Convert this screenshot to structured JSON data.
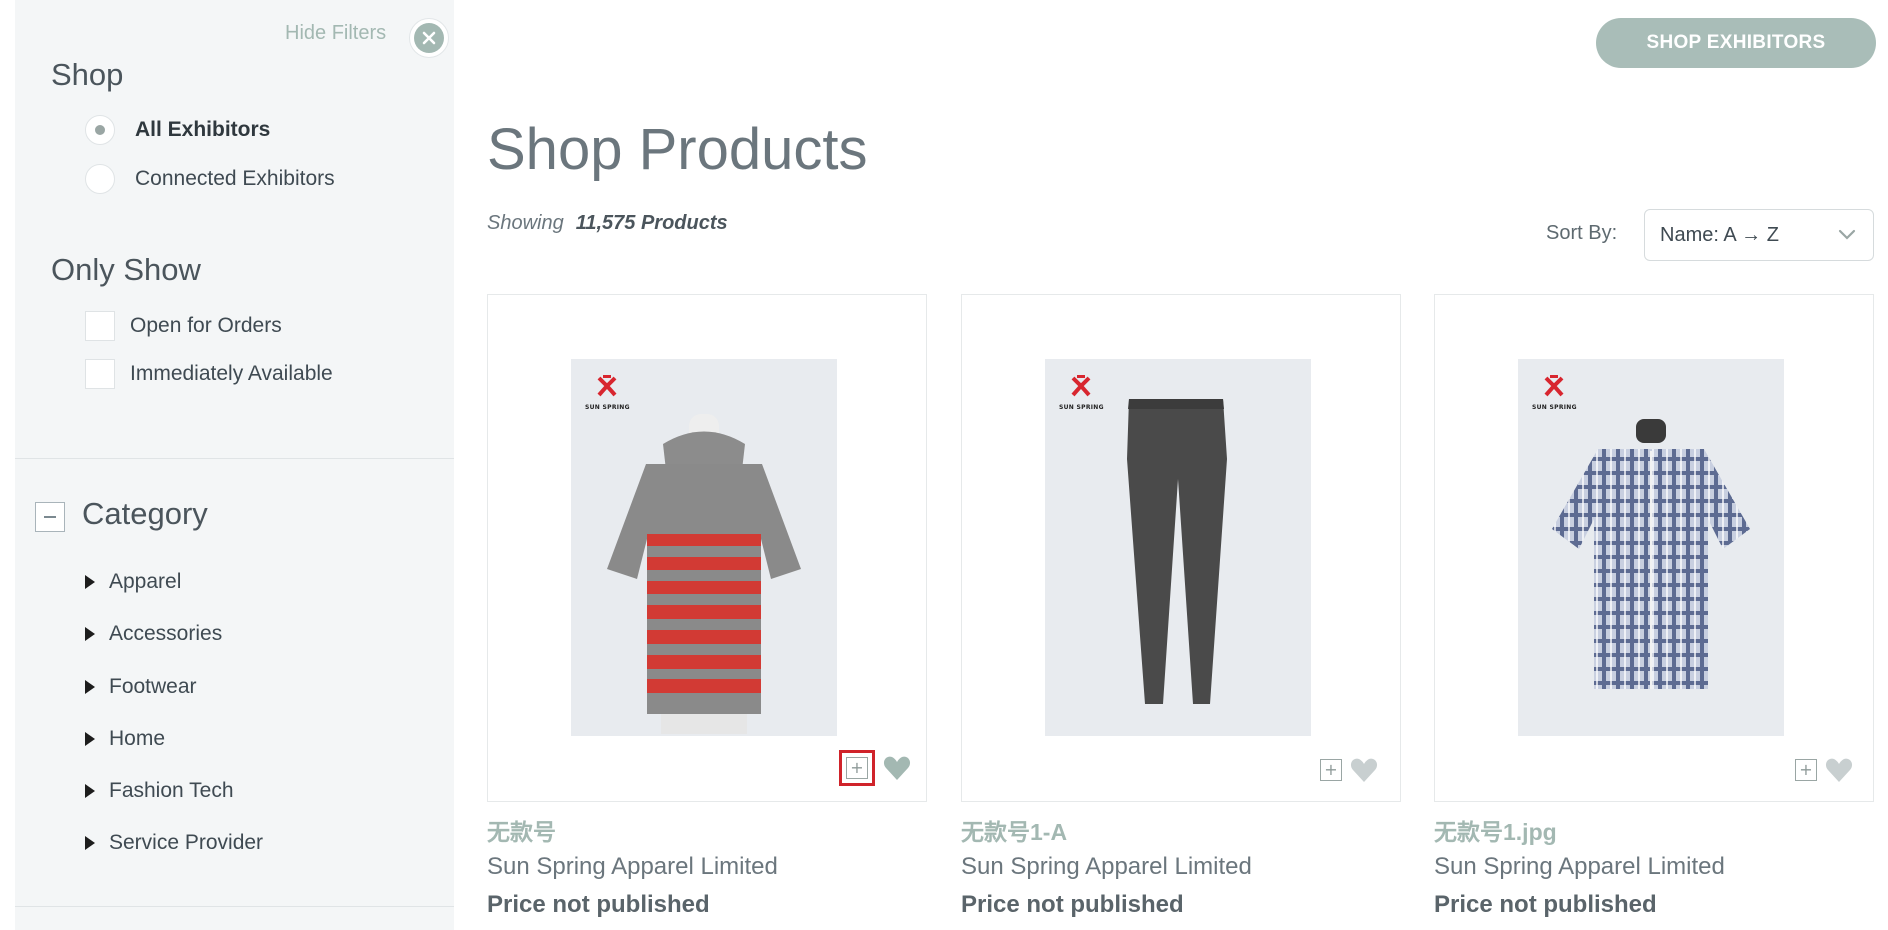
{
  "sidebar": {
    "hide_filters_label": "Hide Filters",
    "shop": {
      "title": "Shop",
      "options": [
        {
          "label": "All Exhibitors",
          "selected": true
        },
        {
          "label": "Connected Exhibitors",
          "selected": false
        }
      ]
    },
    "only_show": {
      "title": "Only Show",
      "options": [
        {
          "label": "Open for Orders",
          "checked": false
        },
        {
          "label": "Immediately Available",
          "checked": false
        }
      ]
    },
    "category": {
      "title": "Category",
      "items": [
        "Apparel",
        "Accessories",
        "Footwear",
        "Home",
        "Fashion Tech",
        "Service Provider"
      ]
    }
  },
  "header": {
    "shop_exhibitors_label": "SHOP EXHIBITORS",
    "page_title": "Shop Products",
    "showing_prefix": "Showing",
    "showing_count": "11,575 Products",
    "sort_label": "Sort By:",
    "sort_value": "Name: A → Z"
  },
  "products": [
    {
      "name": "无款号",
      "vendor": "Sun Spring Apparel Limited",
      "price": "Price not published",
      "brand": "SUN SPRING"
    },
    {
      "name": "无款号1-A",
      "vendor": "Sun Spring Apparel Limited",
      "price": "Price not published",
      "brand": "SUN SPRING"
    },
    {
      "name": "无款号1.jpg",
      "vendor": "Sun Spring Apparel Limited",
      "price": "Price not published",
      "brand": "SUN SPRING"
    }
  ],
  "colors": {
    "accent": "#a9bdb8",
    "highlight": "#d0232a",
    "brand_logo": "#d8262f"
  },
  "icons": {
    "close": "close-circle-icon",
    "chevron": "chevron-down-icon",
    "add": "plus-icon",
    "favorite": "heart-icon",
    "collapse": "minus-icon",
    "expand": "triangle-right-icon"
  }
}
